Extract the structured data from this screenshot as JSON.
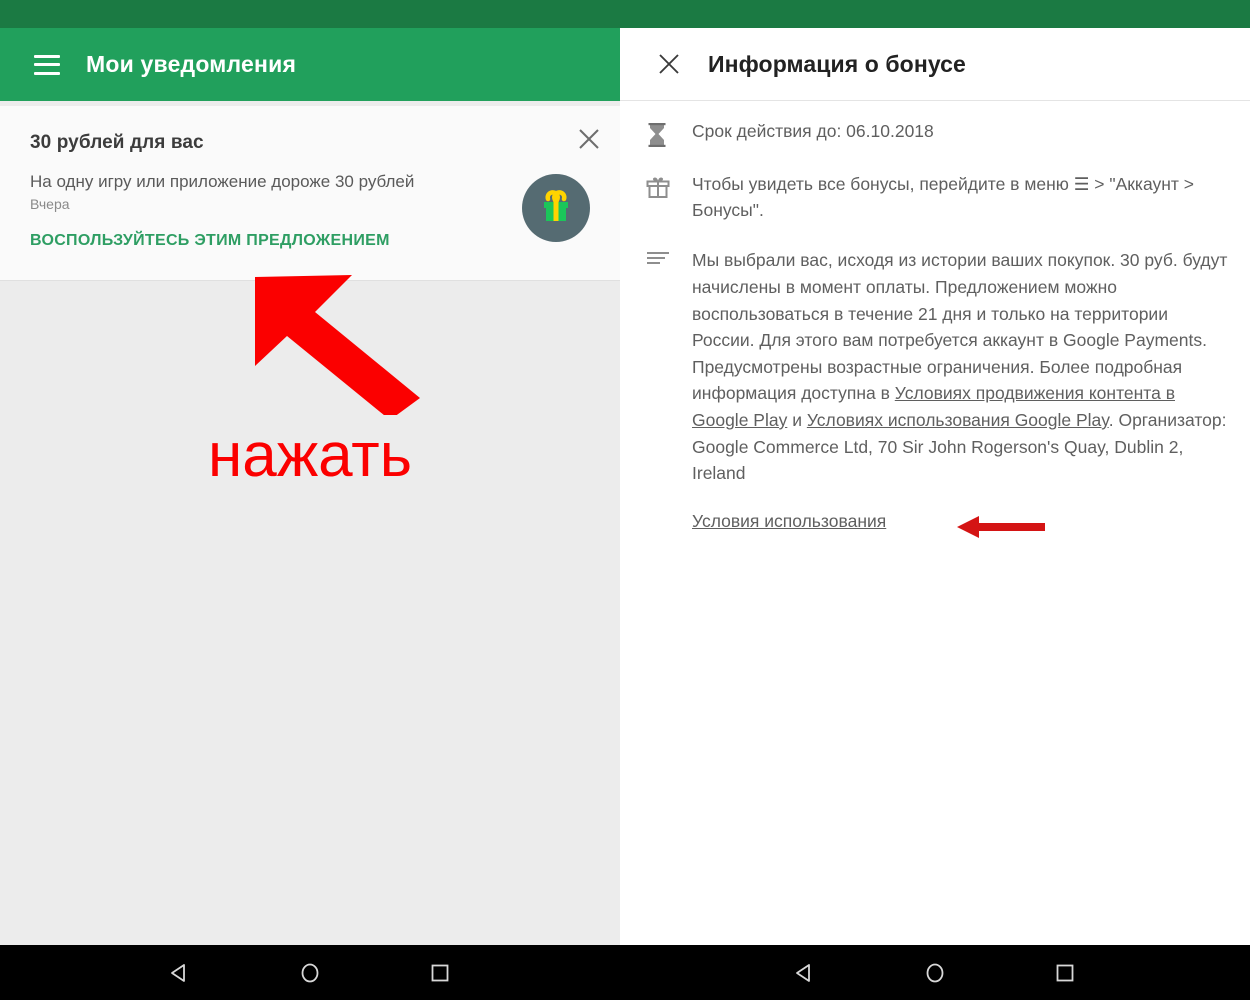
{
  "left_screen": {
    "toolbar": {
      "menu_icon": "hamburger-menu-icon",
      "title": "Мои уведомления"
    },
    "notification": {
      "title": "30 рублей для вас",
      "subtitle": "На одну игру или приложение дороже 30 рублей",
      "time": "Вчера",
      "action_label": "ВОСПОЛЬЗУЙТЕСЬ ЭТИМ ПРЕДЛОЖЕНИЕМ",
      "close_icon": "close-icon",
      "avatar_icon": "gift-icon"
    },
    "annotation": {
      "label": "нажать",
      "arrow": "red-arrow-up-left"
    }
  },
  "right_screen": {
    "toolbar": {
      "close_icon": "close-icon",
      "title": "Информация о бонусе"
    },
    "rows": [
      {
        "icon": "hourglass-icon",
        "text": "Срок действия до: 06.10.2018"
      },
      {
        "icon": "gift-outline-icon",
        "text": "Чтобы увидеть все бонусы, перейдите в меню ☰ > \"Аккаунт > Бонусы\"."
      },
      {
        "icon": "description-lines-icon",
        "text_part_1": "Мы выбрали вас, исходя из истории ваших покупок. 30 руб. будут начислены в момент оплаты. Предложением можно воспользоваться в течение 21 дня и только на территории России. Для этого вам потребуется аккаунт в Google Payments. Предусмотрены возрастные ограничения. Более подробная информация доступна в ",
        "link_1": "Условиях продвижения контента в Google Play",
        "text_part_2": " и ",
        "link_2": "Условиях использования Google Play",
        "text_part_3": ". Организатор: Google Commerce Ltd, 70 Sir John Rogerson's Quay, Dublin 2, Ireland"
      }
    ],
    "terms_link": "Условия использования",
    "annotation": {
      "arrow": "red-arrow-left"
    }
  },
  "nav_bar": {
    "back_icon": "back-triangle-icon",
    "home_icon": "home-circle-icon",
    "recents_icon": "recents-square-icon"
  },
  "colors": {
    "status_bar_green": "#1b7a43",
    "toolbar_green": "#21a05c",
    "action_green": "#2e9e63",
    "annotation_red": "#fb0000",
    "avatar_bg": "#556b72",
    "gift_green": "#1bc65a",
    "gift_yellow": "#ffd400",
    "page_bg": "#ececec",
    "card_bg": "#fafafa"
  }
}
